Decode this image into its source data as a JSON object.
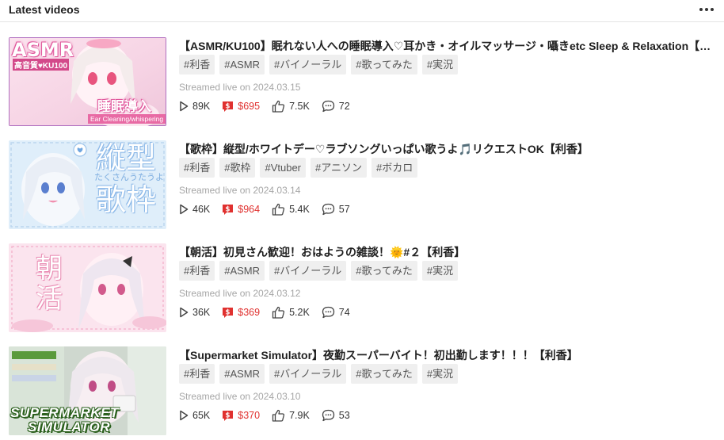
{
  "header": {
    "title": "Latest videos",
    "more_label": "More options"
  },
  "videos": [
    {
      "title": "【ASMR/KU100】眠れない人への睡眠導入♡耳かき・オイルマッサージ・囁きetc Sleep & Relaxation【…",
      "tags": [
        "#利香",
        "#ASMR",
        "#バイノーラル",
        "#歌ってみた",
        "#実況"
      ],
      "date": "Streamed live on 2024.03.15",
      "views": "89K",
      "revenue": "$695",
      "likes": "7.5K",
      "comments": "72",
      "thumb": {
        "badge": "ASMR",
        "sub": "高音質♥KU100",
        "caption": "睡眠導入",
        "footer": "Ear Cleaning/whispering"
      }
    },
    {
      "title": "【歌枠】縦型/ホワイトデー♡ラブソングいっぱい歌うよ🎵リクエストOK【利香】",
      "tags": [
        "#利香",
        "#歌枠",
        "#Vtuber",
        "#アニソン",
        "#ボカロ"
      ],
      "date": "Streamed live on 2024.03.14",
      "views": "46K",
      "revenue": "$964",
      "likes": "5.4K",
      "comments": "57",
      "thumb": {
        "line1": "縦型",
        "line2": "歌枠",
        "sub": "たくさんうたうよ"
      }
    },
    {
      "title": "【朝活】初見さん歓迎！おはようの雑談！🌞#２【利香】",
      "tags": [
        "#利香",
        "#ASMR",
        "#バイノーラル",
        "#歌ってみた",
        "#実況"
      ],
      "date": "Streamed live on 2024.03.12",
      "views": "36K",
      "revenue": "$369",
      "likes": "5.2K",
      "comments": "74",
      "thumb": {
        "line1": "朝",
        "line2": "活"
      }
    },
    {
      "title": "【Supermarket Simulator】夜勤スーパーバイト！初出勤します！！！【利香】",
      "tags": [
        "#利香",
        "#ASMR",
        "#バイノーラル",
        "#歌ってみた",
        "#実況"
      ],
      "date": "Streamed live on 2024.03.10",
      "views": "65K",
      "revenue": "$370",
      "likes": "7.9K",
      "comments": "53",
      "thumb": {
        "line1": "SUPERMARKET",
        "line2": "SIMULATOR"
      }
    }
  ],
  "colors": {
    "revenue": "#e0312f",
    "tag_bg": "#efefef",
    "date": "#a6a6a6"
  },
  "icons": {
    "views": "play-icon",
    "revenue": "dollar-icon",
    "likes": "thumbs-up-icon",
    "comments": "comment-icon"
  }
}
